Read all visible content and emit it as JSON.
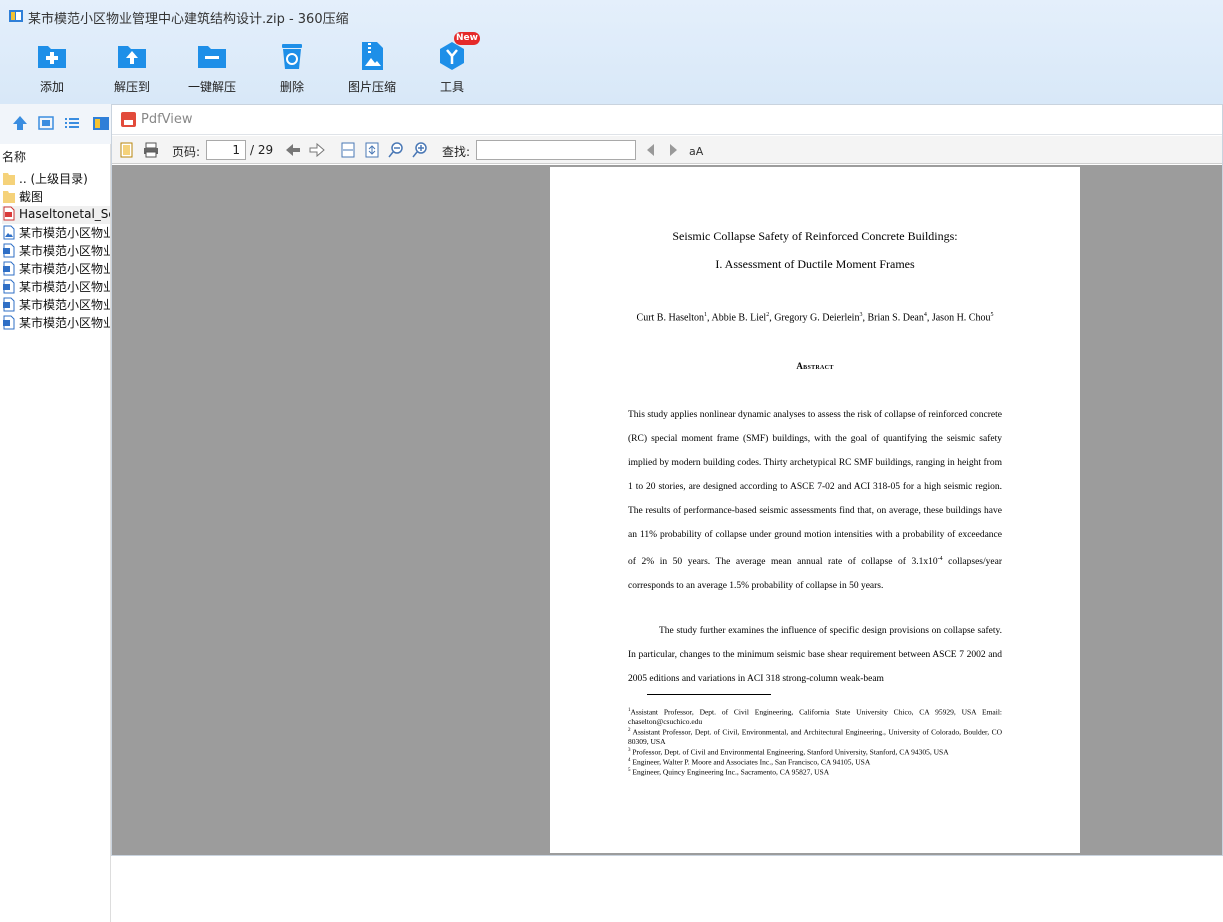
{
  "window": {
    "title": "某市模范小区物业管理中心建筑结构设计.zip - 360压缩"
  },
  "toolbar": {
    "items": [
      {
        "label": "添加",
        "icon": "add-folder-icon"
      },
      {
        "label": "解压到",
        "icon": "extract-to-icon"
      },
      {
        "label": "一键解压",
        "icon": "one-click-extract-icon"
      },
      {
        "label": "删除",
        "icon": "recycle-bin-icon"
      },
      {
        "label": "图片压缩",
        "icon": "image-compress-icon"
      },
      {
        "label": "工具",
        "icon": "tools-icon"
      }
    ],
    "new_badge": "New"
  },
  "filelist": {
    "column_name": "名称",
    "rows": [
      {
        "name": ".. (上级目录)",
        "icon": "folder-icon"
      },
      {
        "name": "截图",
        "icon": "folder-icon"
      },
      {
        "name": "Haseltonetal_Se",
        "icon": "pdf-file-icon"
      },
      {
        "name": "某市模范小区物业",
        "icon": "image-file-icon"
      },
      {
        "name": "某市模范小区物业",
        "icon": "word-file-icon"
      },
      {
        "name": "某市模范小区物业",
        "icon": "word-file-icon"
      },
      {
        "name": "某市模范小区物业",
        "icon": "word-file-icon"
      },
      {
        "name": "某市模范小区物业",
        "icon": "word-file-icon"
      },
      {
        "name": "某市模范小区物业",
        "icon": "word-file-icon"
      }
    ]
  },
  "pdfview": {
    "name": "PdfView",
    "page_label": "页码:",
    "current_page": "1",
    "total_pages": "/ 29",
    "find_label": "查找:",
    "find_value": ""
  },
  "document": {
    "title_line1": "Seismic Collapse Safety of Reinforced Concrete Buildings:",
    "title_line2": "I. Assessment of Ductile Moment Frames",
    "authors": [
      {
        "name": "Curt B. Haselton",
        "sup": "1"
      },
      {
        "name": "Abbie B. Liel",
        "sup": "2"
      },
      {
        "name": "Gregory G. Deierlein",
        "sup": "3"
      },
      {
        "name": "Brian S. Dean",
        "sup": "4"
      },
      {
        "name": "Jason H. Chou",
        "sup": "5"
      }
    ],
    "abstract_heading": "Abstract",
    "para1": "This study applies nonlinear dynamic analyses to assess the risk of collapse of reinforced concrete (RC) special moment frame (SMF) buildings, with the goal of quantifying the seismic safety implied by modern building codes. Thirty archetypical RC SMF buildings, ranging in height from 1 to 20 stories, are designed according to ASCE 7-02 and ACI 318-05 for a high seismic region. The results of performance-based seismic assessments find that, on average, these buildings have an 11% probability of collapse under ground motion intensities with a probability of exceedance of 2% in 50 years.  The average mean annual rate of collapse of 3.1x10",
    "para1_exp": "-4",
    "para1_tail": " collapses/year corresponds to an average 1.5% probability of collapse in 50 years.",
    "para2": "The study further examines the influence of specific design provisions on collapse safety.  In particular, changes to the minimum seismic base shear requirement between ASCE 7 2002 and 2005 editions and variations in ACI 318 strong-column weak-beam",
    "footnotes": [
      {
        "sup": "1",
        "text": "Assistant Professor, Dept. of Civil Engineering, California State University Chico, CA 95929, USA Email: chaselton@csuchico.edu"
      },
      {
        "sup": "2",
        "text": " Assistant Professor, Dept. of Civil, Environmental, and Architectural Engineering., University of Colorado, Boulder, CO 80309, USA"
      },
      {
        "sup": "3",
        "text": " Professor, Dept. of Civil and Environmental Engineering, Stanford University, Stanford, CA 94305, USA"
      },
      {
        "sup": "4",
        "text": " Engineer, Walter P. Moore and Associates Inc., San Francisco, CA 94105, USA"
      },
      {
        "sup": "5",
        "text": " Engineer, Quincy Engineering Inc., Sacramento, CA 95827, USA"
      }
    ]
  },
  "colors": {
    "toolbar_icon_blue": "#1e8fe8",
    "canvas_gray": "#9c9c9c",
    "badge_red": "#e52a2a"
  }
}
